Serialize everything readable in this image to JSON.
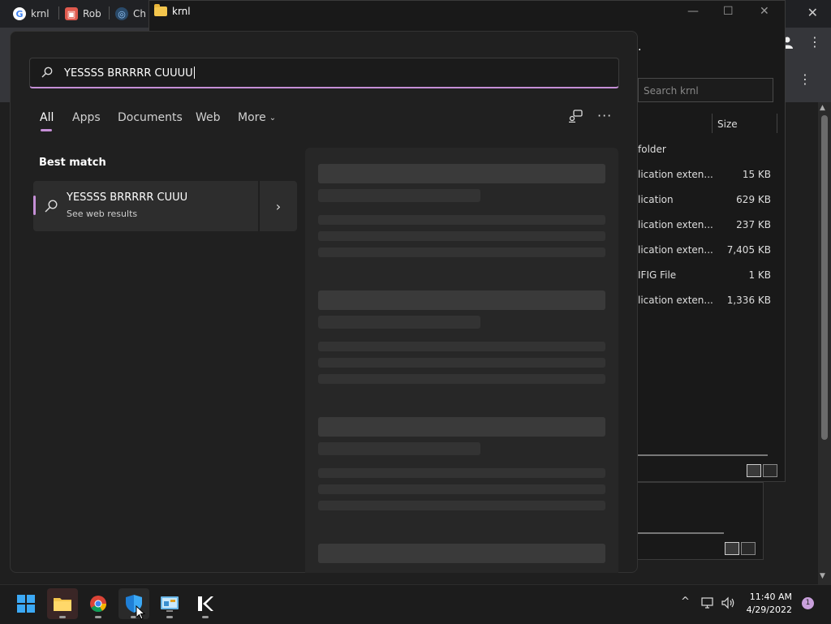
{
  "browser": {
    "tabs": [
      {
        "label": "krnl",
        "icon": "google-icon"
      },
      {
        "label": "Rob",
        "icon": "roblox-icon"
      },
      {
        "label": "Ch",
        "icon": "page-icon"
      }
    ]
  },
  "explorer": {
    "title": "krnl",
    "search_placeholder": "Search krnl",
    "column_size": "Size",
    "rows": [
      {
        "type": "folder",
        "size": ""
      },
      {
        "type": "lication exten...",
        "size": "15 KB"
      },
      {
        "type": "lication",
        "size": "629 KB"
      },
      {
        "type": "lication exten...",
        "size": "237 KB"
      },
      {
        "type": "lication exten...",
        "size": "7,405 KB"
      },
      {
        "type": "IFIG File",
        "size": "1 KB"
      },
      {
        "type": "lication exten...",
        "size": "1,336 KB"
      }
    ]
  },
  "search": {
    "query": "YESSSS BRRRRR CUUUU",
    "tabs": {
      "all": "All",
      "apps": "Apps",
      "documents": "Documents",
      "web": "Web",
      "more": "More"
    },
    "more_chevron": "⌄",
    "more_options": "···",
    "best_match_label": "Best match",
    "result": {
      "title": "YESSSS BRRRRR CUUU",
      "subtitle": "See web results",
      "arrow": "›"
    }
  },
  "taskbar": {
    "apps": [
      "start-icon",
      "file-explorer-icon",
      "chrome-icon",
      "windows-security-icon",
      "control-panel-icon",
      "krnl-icon"
    ],
    "tray_chevron": "^",
    "time": "11:40 AM",
    "date": "4/29/2022",
    "notification_count": "1"
  },
  "colors": {
    "accent": "#c58fd6",
    "panel_bg": "#202020",
    "taskbar_bg": "#1c1c1c"
  }
}
